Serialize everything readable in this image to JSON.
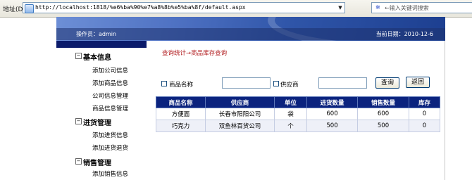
{
  "browser": {
    "address_label": "地址(D)",
    "url": "http://localhost:1818/%e6%ba%90%e7%a8%8b%e5%ba%8f/default.aspx",
    "search_placeholder": "←输入关键词搜索"
  },
  "header": {
    "operator": "操作员：admin",
    "current_date": "当前日期：2010-12-6"
  },
  "sidebar": {
    "sections": [
      {
        "title": "基本信息",
        "toggle": "−",
        "items": [
          "添加公司信息",
          "添加商品信息",
          "公司信息管理",
          "商品信息管理"
        ]
      },
      {
        "title": "进货管理",
        "toggle": "−",
        "items": [
          "添加进货信息",
          "添加进货退货"
        ]
      },
      {
        "title": "销售管理",
        "toggle": "−",
        "items": [
          "添加销售信息"
        ]
      }
    ]
  },
  "main": {
    "breadcrumb": "查询统计→商品库存查询",
    "filters": {
      "product_name_label": "商品名称",
      "product_name_value": "",
      "supplier_label": "供应商",
      "supplier_value": "",
      "query_button": "查询",
      "back_button": "返回"
    },
    "table": {
      "columns": [
        "商品名称",
        "供应商",
        "单位",
        "进货数量",
        "销售数量",
        "库存"
      ],
      "rows": [
        [
          "方便面",
          "长春市阳阳公司",
          "袋",
          "600",
          "600",
          "0"
        ],
        [
          "巧克力",
          "双鱼林百货公司",
          "个",
          "500",
          "500",
          "0"
        ]
      ]
    }
  }
}
